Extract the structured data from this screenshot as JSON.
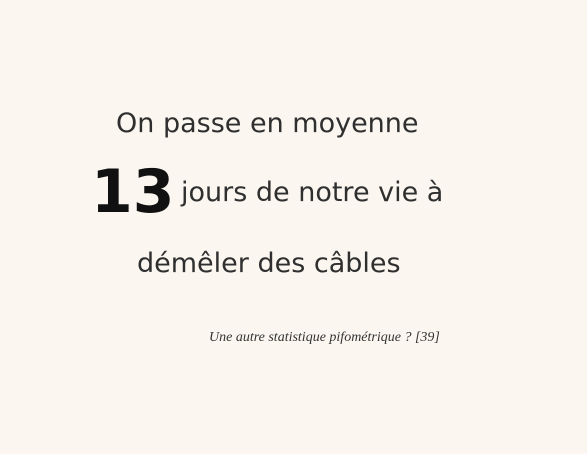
{
  "statement": {
    "line1": "On passe en moyenne",
    "number": "13",
    "line2": "jours de notre vie à",
    "line3": "démêler des câbles"
  },
  "caption": "Une autre statistique pifométrique ? [39]",
  "colors": {
    "background": "#fbf7f0",
    "text": "#2f2f2f",
    "number": "#111111"
  }
}
